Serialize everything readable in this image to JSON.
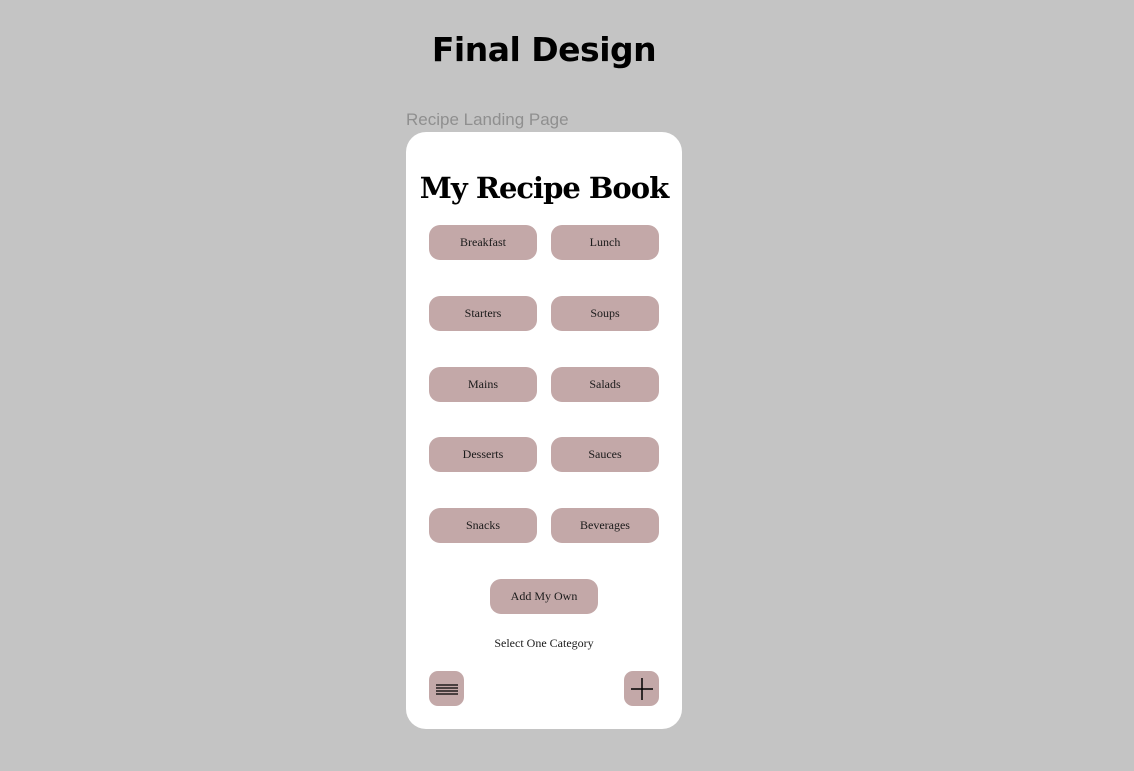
{
  "page": {
    "heading": "Final Design",
    "frame_label": "Recipe Landing Page"
  },
  "app": {
    "title": "My Recipe Book",
    "categories": [
      "Breakfast",
      "Lunch",
      "Starters",
      "Soups",
      "Mains",
      "Salads",
      "Desserts",
      "Sauces",
      "Snacks",
      "Beverages"
    ],
    "add_own_label": "Add My Own",
    "hint": "Select One Category"
  },
  "icons": {
    "menu": "hamburger-menu-icon",
    "add": "plus-icon"
  },
  "colors": {
    "canvas": "#c4c4c4",
    "screen": "#ffffff",
    "button": "#c3a8a8",
    "text": "#000000",
    "label": "#8f8f8f"
  }
}
